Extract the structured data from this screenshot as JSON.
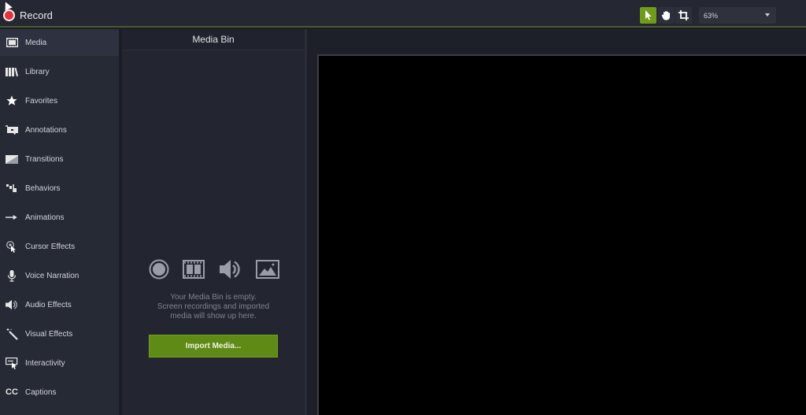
{
  "topbar": {
    "record_label": "Record",
    "tools": [
      {
        "name": "select-tool",
        "icon": "arrow-pointer-icon",
        "active": true
      },
      {
        "name": "pan-tool",
        "icon": "hand-icon",
        "active": false
      },
      {
        "name": "crop-tool",
        "icon": "crop-icon",
        "active": false
      }
    ],
    "zoom_level": "63%",
    "accent_color": "#6f9d1a"
  },
  "sidebar": {
    "items": [
      {
        "label": "Media",
        "icon": "film-icon",
        "active": true
      },
      {
        "label": "Library",
        "icon": "library-icon",
        "active": false
      },
      {
        "label": "Favorites",
        "icon": "star-icon",
        "active": false
      },
      {
        "label": "Annotations",
        "icon": "annotation-icon",
        "active": false
      },
      {
        "label": "Transitions",
        "icon": "transition-icon",
        "active": false
      },
      {
        "label": "Behaviors",
        "icon": "behaviors-icon",
        "active": false
      },
      {
        "label": "Animations",
        "icon": "arrow-right-icon",
        "active": false
      },
      {
        "label": "Cursor Effects",
        "icon": "cursor-effects-icon",
        "active": false
      },
      {
        "label": "Voice Narration",
        "icon": "microphone-icon",
        "active": false
      },
      {
        "label": "Audio Effects",
        "icon": "speaker-icon",
        "active": false
      },
      {
        "label": "Visual Effects",
        "icon": "magic-wand-icon",
        "active": false
      },
      {
        "label": "Interactivity",
        "icon": "interactivity-icon",
        "active": false
      },
      {
        "label": "Captions",
        "icon": "cc-icon",
        "active": false
      }
    ]
  },
  "media_bin": {
    "title": "Media Bin",
    "empty_icons": [
      "record-icon",
      "film-icon",
      "speaker-icon",
      "image-icon"
    ],
    "empty_message_lines": [
      "Your Media Bin is empty.",
      "Screen recordings and imported",
      "media will show up here."
    ],
    "import_button": "Import Media...",
    "button_color": "#5e8a15"
  },
  "captions_glyph": "CC"
}
